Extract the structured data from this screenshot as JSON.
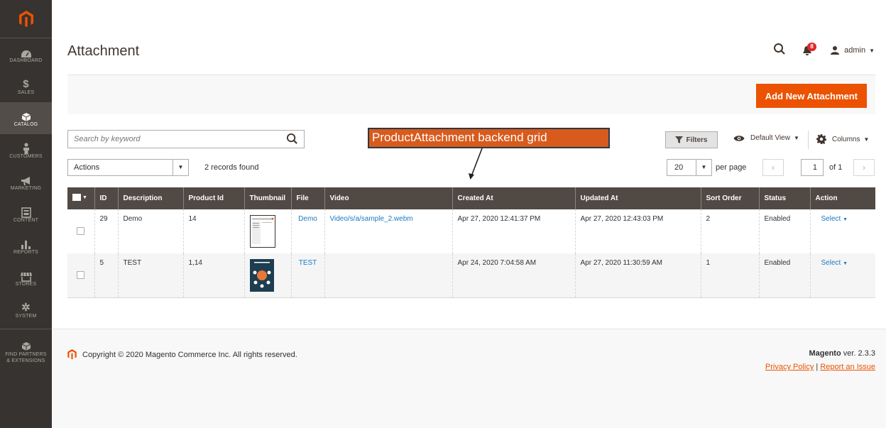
{
  "sidebar": {
    "logo": "magento-logo",
    "items": [
      {
        "label": "DASHBOARD",
        "icon": "dashboard-icon"
      },
      {
        "label": "SALES",
        "icon": "dollar-icon"
      },
      {
        "label": "CATALOG",
        "icon": "cube-icon"
      },
      {
        "label": "CUSTOMERS",
        "icon": "person-icon"
      },
      {
        "label": "MARKETING",
        "icon": "megaphone-icon"
      },
      {
        "label": "CONTENT",
        "icon": "content-icon"
      },
      {
        "label": "REPORTS",
        "icon": "bar-chart-icon"
      },
      {
        "label": "STORES",
        "icon": "store-icon"
      },
      {
        "label": "SYSTEM",
        "icon": "gear-icon"
      }
    ],
    "partners_line1": "FIND PARTNERS",
    "partners_line2": "& EXTENSIONS"
  },
  "header": {
    "title": "Attachment",
    "notifications_count": "8",
    "user": "admin"
  },
  "actionbar": {
    "add_button": "Add New Attachment"
  },
  "toolbar": {
    "search_placeholder": "Search by keyword",
    "filters": "Filters",
    "view": "Default View",
    "columns": "Columns",
    "actions": "Actions",
    "records": "2 records found",
    "per_page_value": "20",
    "per_page_label": "per page",
    "page_value": "1",
    "page_of": "of 1"
  },
  "callout": "ProductAttachment backend grid",
  "grid": {
    "columns": [
      "ID",
      "Description",
      "Product Id",
      "Thumbnail",
      "File",
      "Video",
      "Created At",
      "Updated At",
      "Sort Order",
      "Status",
      "Action"
    ],
    "rows": [
      {
        "id": "29",
        "description": "Demo",
        "product_id": "14",
        "file": "Demo",
        "video": "Video/s/a/sample_2.webm",
        "created": "Apr 27, 2020 12:41:37 PM",
        "updated": "Apr 27, 2020 12:43:03 PM",
        "sort": "2",
        "status": "Enabled",
        "action": "Select"
      },
      {
        "id": "5",
        "description": "TEST",
        "product_id": "1,14",
        "file": "TEST",
        "video": "",
        "created": "Apr 24, 2020 7:04:58 AM",
        "updated": "Apr 27, 2020 11:30:59 AM",
        "sort": "1",
        "status": "Enabled",
        "action": "Select"
      }
    ]
  },
  "footer": {
    "copyright": "Copyright © 2020 Magento Commerce Inc. All rights reserved.",
    "brand": "Magento",
    "version": " ver. 2.3.3",
    "privacy": "Privacy Policy",
    "separator": " | ",
    "report": "Report an Issue"
  },
  "colors": {
    "accent": "#eb5202",
    "sidebar": "#373330",
    "header_row": "#514943",
    "link": "#1979c3",
    "callout": "#d85b1d"
  }
}
